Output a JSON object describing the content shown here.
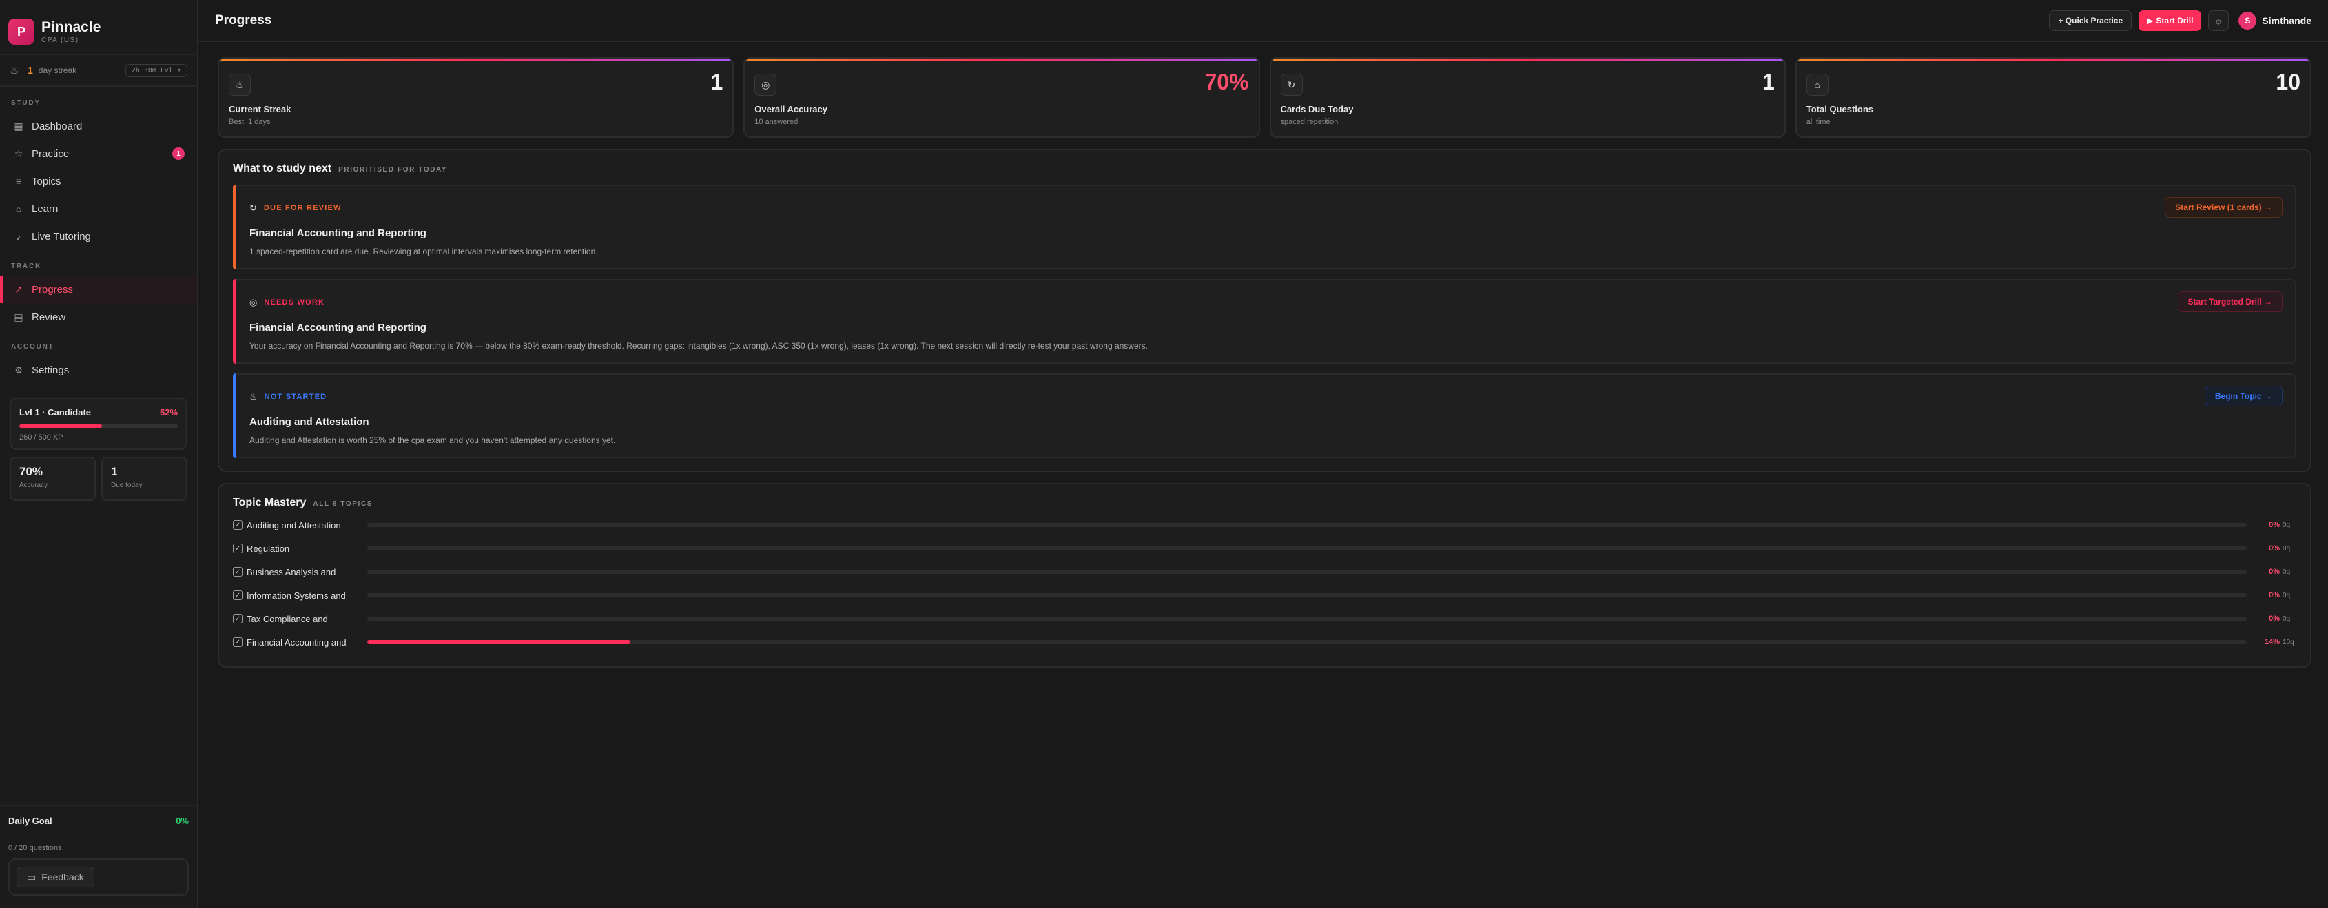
{
  "brand": {
    "logo_letter": "P",
    "name": "Pinnacle",
    "subtitle": "CPA (US)"
  },
  "streak": {
    "icon": "flame-icon",
    "count": "1",
    "label": "day streak",
    "timer": "2h 30m Lvl ↑"
  },
  "nav": {
    "study_label": "STUDY",
    "track_label": "TRACK",
    "account_label": "ACCOUNT",
    "items": [
      {
        "label": "Dashboard",
        "icon": "grid-icon"
      },
      {
        "label": "Practice",
        "icon": "star-icon",
        "badge": "1"
      },
      {
        "label": "Topics",
        "icon": "list-icon"
      },
      {
        "label": "Learn",
        "icon": "graduation-cap-icon"
      },
      {
        "label": "Live Tutoring",
        "icon": "microphone-icon"
      },
      {
        "label": "Progress",
        "icon": "trending-up-icon",
        "active": true
      },
      {
        "label": "Review",
        "icon": "review-icon"
      },
      {
        "label": "Settings",
        "icon": "gear-icon"
      }
    ]
  },
  "level": {
    "title": "Lvl 1 · Candidate",
    "pct_label": "52%",
    "progress": 0.52,
    "xp": "260 / 500 XP"
  },
  "mini_stats": [
    {
      "value": "70%",
      "label": "Accuracy"
    },
    {
      "value": "1",
      "label": "Due today"
    }
  ],
  "daily_goal": {
    "title": "Daily Goal",
    "pct": "0%",
    "sub": "0 / 20 questions"
  },
  "feedback": {
    "label": "Feedback"
  },
  "topbar": {
    "title": "Progress",
    "quick_practice": "+ Quick Practice",
    "start_drill": "Start Drill",
    "user_initial": "S",
    "user_name": "Simthande"
  },
  "stats": [
    {
      "value": "1",
      "label": "Current Streak",
      "sub": "Best: 1 days",
      "icon": "flame-icon"
    },
    {
      "value": "70%",
      "label": "Overall Accuracy",
      "sub": "10 answered",
      "icon": "target-icon",
      "accent": true
    },
    {
      "value": "1",
      "label": "Cards Due Today",
      "sub": "spaced repetition",
      "icon": "refresh-icon"
    },
    {
      "value": "10",
      "label": "Total Questions",
      "sub": "all time",
      "icon": "graduation-cap-icon"
    }
  ],
  "study_next": {
    "title": "What to study next",
    "subtitle": "PRIORITISED FOR TODAY",
    "items": [
      {
        "tag": "DUE FOR REVIEW",
        "title": "Financial Accounting and Reporting",
        "desc": "1 spaced-repetition card are due. Reviewing at optimal intervals maximises long-term retention.",
        "button": "Start Review (1 cards) →",
        "accent": "#f0652a",
        "icon": "refresh-icon"
      },
      {
        "tag": "NEEDS WORK",
        "title": "Financial Accounting and Reporting",
        "desc": "Your accuracy on Financial Accounting and Reporting is 70% — below the 80% exam-ready threshold. Recurring gaps: intangibles (1x wrong), ASC 350 (1x wrong), leases (1x wrong). The next session will directly re-test your past wrong answers.",
        "button": "Start Targeted Drill →",
        "accent": "#ff2d5a",
        "icon": "target-icon"
      },
      {
        "tag": "NOT STARTED",
        "title": "Auditing and Attestation",
        "desc": "Auditing and Attestation is worth 25% of the cpa exam and you haven't attempted any questions yet.",
        "button": "Begin Topic →",
        "accent": "#3b7bff",
        "icon": "flame-icon"
      }
    ]
  },
  "topic_mastery": {
    "title": "Topic Mastery",
    "subtitle": "ALL 6 TOPICS",
    "topics": [
      {
        "name": "Auditing and Attestation",
        "pct": "0%",
        "q": "0q",
        "value": 0
      },
      {
        "name": "Regulation",
        "pct": "0%",
        "q": "0q",
        "value": 0
      },
      {
        "name": "Business Analysis and",
        "pct": "0%",
        "q": "0q",
        "value": 0
      },
      {
        "name": "Information Systems and",
        "pct": "0%",
        "q": "0q",
        "value": 0
      },
      {
        "name": "Tax Compliance and",
        "pct": "0%",
        "q": "0q",
        "value": 0
      },
      {
        "name": "Financial Accounting and",
        "pct": "14%",
        "q": "10q",
        "value": 0.14
      }
    ]
  }
}
